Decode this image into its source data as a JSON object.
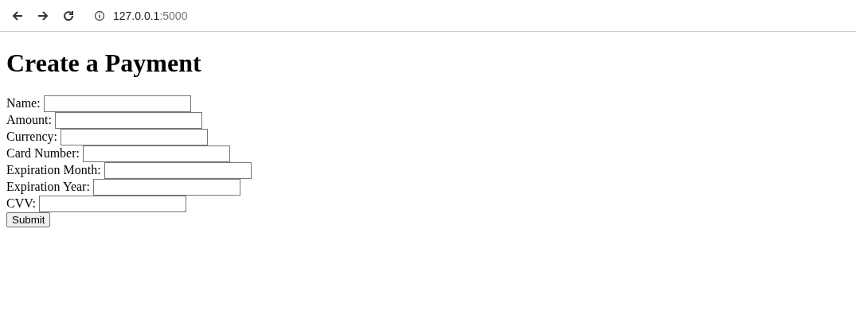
{
  "browser": {
    "url_host": "127.0.0.1",
    "url_port": ":5000"
  },
  "heading": "Create a Payment",
  "fields": [
    {
      "label": "Name:"
    },
    {
      "label": "Amount:"
    },
    {
      "label": "Currency:"
    },
    {
      "label": "Card Number:"
    },
    {
      "label": "Expiration Month:"
    },
    {
      "label": "Expiration Year:"
    },
    {
      "label": "CVV:"
    }
  ],
  "submit": "Submit"
}
